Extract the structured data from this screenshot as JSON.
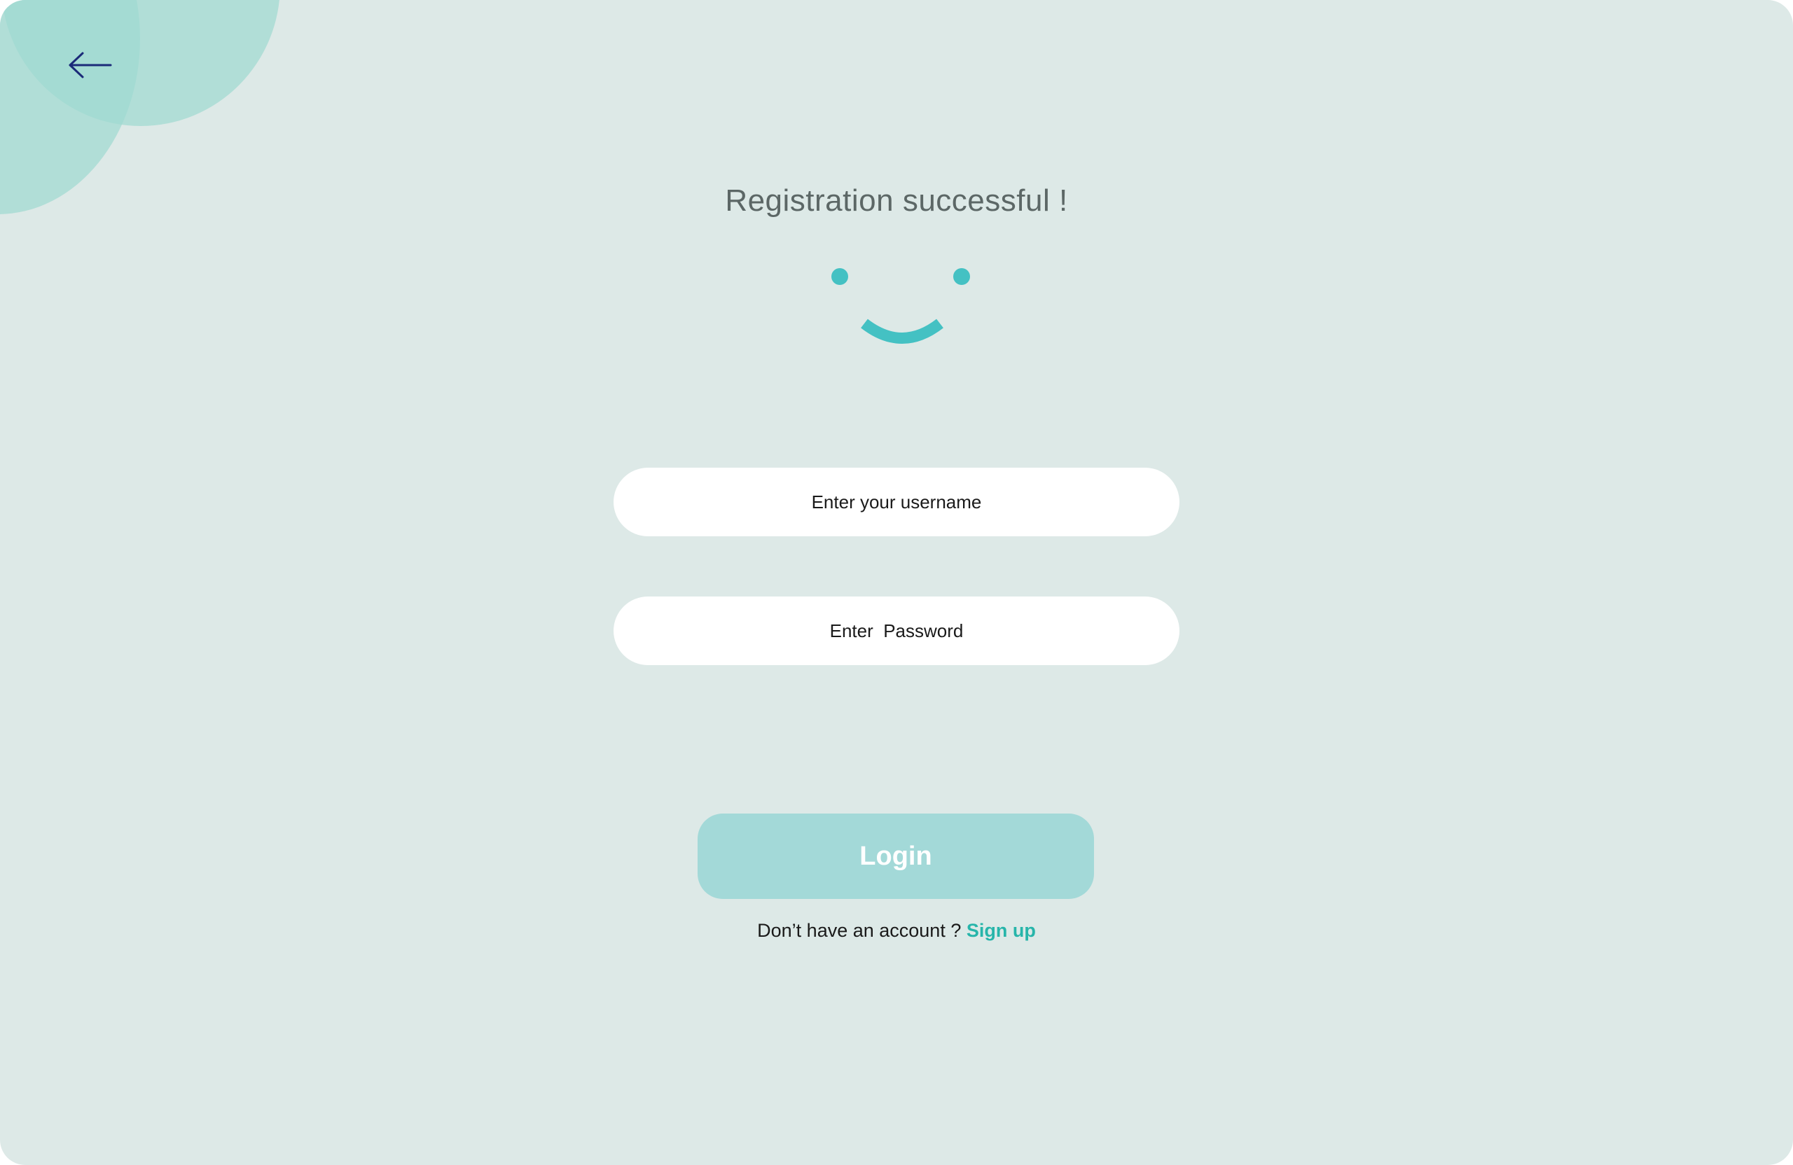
{
  "header": {
    "back_icon": "arrow-left-icon"
  },
  "status": {
    "title": "Registration successful !",
    "illustration": "smiley-face-icon"
  },
  "form": {
    "username_placeholder": "Enter your username",
    "password_placeholder": "Enter  Password",
    "login_label": "Login"
  },
  "footer": {
    "prompt": "Don’t have an account ?",
    "signup_label": "Sign up"
  },
  "colors": {
    "background": "#dde9e7",
    "blob": "#9fd9d1",
    "accent": "#44c1c3",
    "button": "#a3d9d8",
    "link": "#27b5aa",
    "back_icon": "#1b2a78"
  }
}
